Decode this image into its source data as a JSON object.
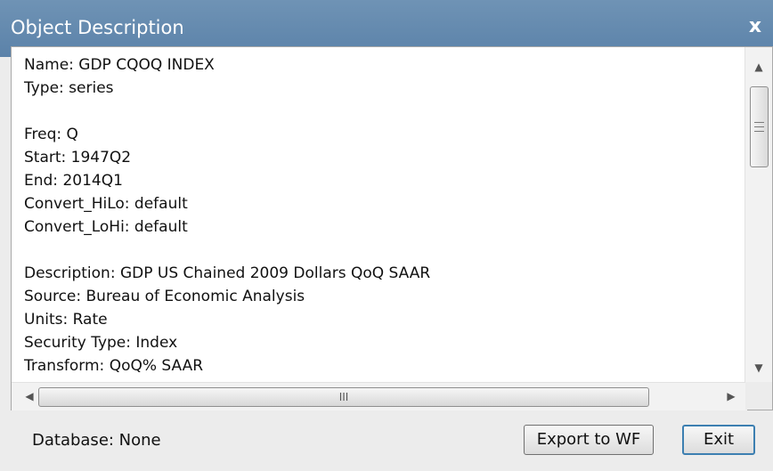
{
  "window": {
    "title": "Object Description",
    "close_glyph": "x"
  },
  "description_lines": [
    "Name: GDP CQOQ INDEX",
    "Type: series",
    "",
    "Freq: Q",
    "Start: 1947Q2",
    "End: 2014Q1",
    "Convert_HiLo: default",
    "Convert_LoHi: default",
    "",
    "Description: GDP US Chained 2009 Dollars QoQ SAAR",
    "Source: Bureau of Economic Analysis",
    "Units: Rate",
    "Security Type: Index",
    "Transform: QoQ% SAAR"
  ],
  "scrollbars": {
    "up_glyph": "▲",
    "down_glyph": "▼",
    "left_glyph": "◀",
    "right_glyph": "▶",
    "h_grip": "III"
  },
  "footer": {
    "database_label": "Database: None",
    "export_button": "Export to WF",
    "exit_button": "Exit"
  }
}
